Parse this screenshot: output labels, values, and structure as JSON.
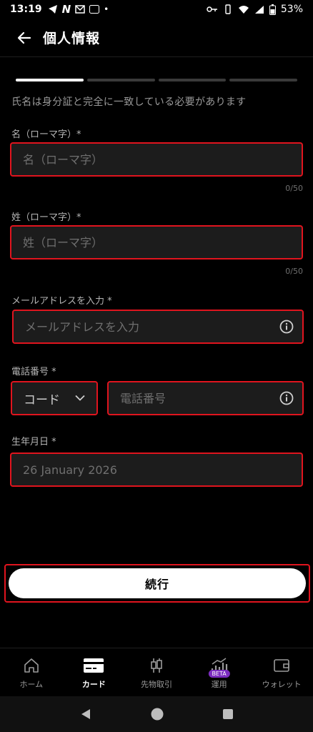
{
  "status_bar": {
    "time": "13:19",
    "battery": "53%"
  },
  "header": {
    "title": "個人情報"
  },
  "progress": {
    "steps_total": 4,
    "current_step": 1
  },
  "notice": "氏名は身分証と完全に一致している必要があります",
  "form": {
    "first_name": {
      "label": "名（ローマ字）*",
      "placeholder": "名（ローマ字）",
      "counter": "0/50"
    },
    "last_name": {
      "label": "姓（ローマ字）*",
      "placeholder": "姓（ローマ字）",
      "counter": "0/50"
    },
    "email": {
      "label": "メールアドレスを入力 *",
      "placeholder": "メールアドレスを入力"
    },
    "phone": {
      "label": "電話番号 *",
      "code_value": "コード",
      "placeholder": "電話番号"
    },
    "birthdate": {
      "label": "生年月日 *",
      "value": "26 January 2026"
    }
  },
  "cta": {
    "label": "続行"
  },
  "bottom_nav": {
    "items": [
      {
        "label": "ホーム",
        "icon": "home-icon"
      },
      {
        "label": "カード",
        "icon": "card-icon"
      },
      {
        "label": "先物取引",
        "icon": "candlestick-icon"
      },
      {
        "label": "運用",
        "icon": "chart-bars-icon",
        "badge": "BETA"
      },
      {
        "label": "ウォレット",
        "icon": "wallet-icon"
      }
    ],
    "active_index": 1
  },
  "colors": {
    "highlight": "#e0141e",
    "field_bg": "#1c1c1c",
    "background": "#000000",
    "beta_badge": "#7b2cbf"
  }
}
